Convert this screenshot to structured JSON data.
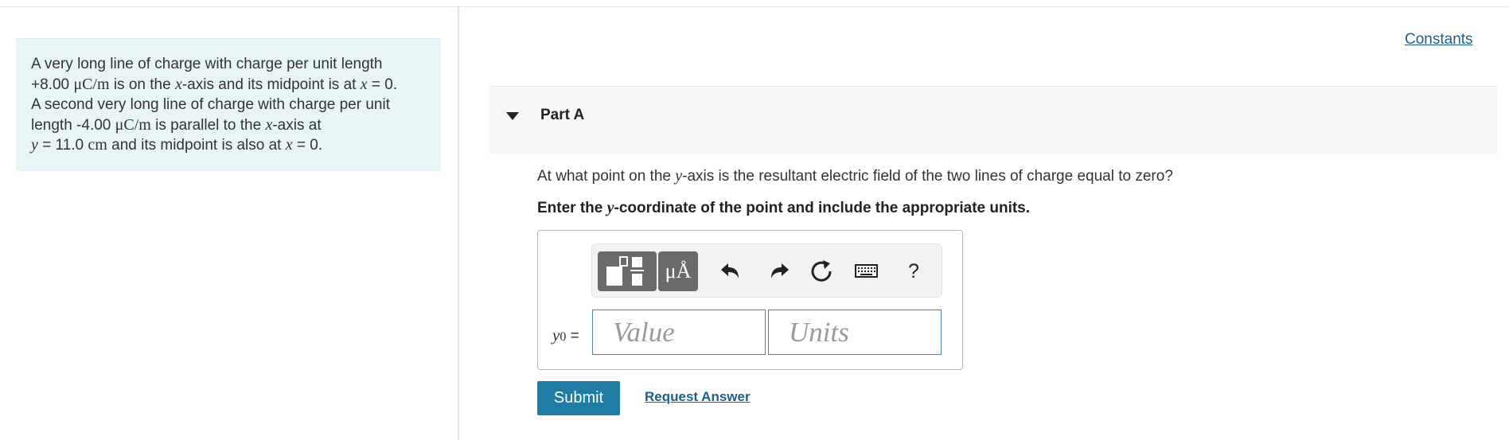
{
  "problem": {
    "lines": [
      [
        "A very long line of charge with charge per unit length"
      ],
      [
        "+8.00 ",
        "μC/m",
        " is on the ",
        "x",
        "-axis and its midpoint is at ",
        "x",
        " = 0."
      ],
      [
        "A second very long line of charge with charge per unit"
      ],
      [
        "length -4.00 ",
        "μC/m",
        " is parallel to the ",
        "x",
        "-axis at"
      ],
      [
        "y",
        " = 11.0 ",
        "cm",
        " and its midpoint is also at ",
        "x",
        " = 0."
      ]
    ]
  },
  "links": {
    "constants": "Constants"
  },
  "part": {
    "title": "Part A"
  },
  "question": {
    "before": "At what point on the ",
    "var": "y",
    "after": "-axis is the resultant electric field of the two lines of charge equal to zero?"
  },
  "instruction": {
    "before": "Enter the ",
    "var": "y",
    "after": "-coordinate of the point and include the appropriate units."
  },
  "answer": {
    "label_var": "y",
    "label_sub": "0",
    "label_eq": " =",
    "value_placeholder": "Value",
    "units_placeholder": "Units"
  },
  "toolbar": {
    "units_label": "μÅ",
    "help_label": "?",
    "icons": [
      "templates-icon",
      "units-icon",
      "undo-icon",
      "redo-icon",
      "reset-icon",
      "keyboard-icon",
      "help-icon"
    ]
  },
  "actions": {
    "submit": "Submit",
    "request_answer": "Request Answer"
  },
  "colors": {
    "problem_bg": "#e8f5f6",
    "submit_bg": "#217ca4",
    "link": "#1d5f8c",
    "field_border": "#4a86a8"
  }
}
